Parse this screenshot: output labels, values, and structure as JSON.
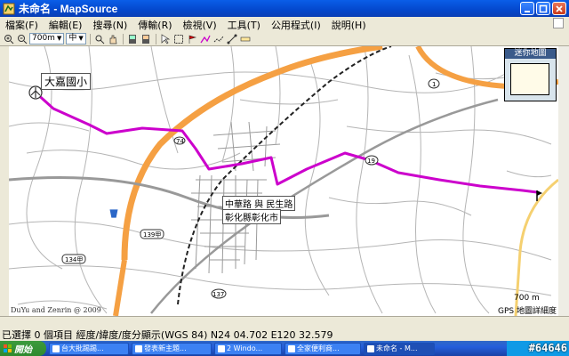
{
  "window": {
    "title": "未命名 - MapSource"
  },
  "menu": {
    "items": [
      "檔案(F)",
      "編輯(E)",
      "搜尋(N)",
      "傳輸(R)",
      "檢視(V)",
      "工具(T)",
      "公用程式(I)",
      "說明(H)"
    ]
  },
  "toolbar": {
    "zoom_value": "700m",
    "detail_value": "中"
  },
  "map": {
    "labels": {
      "start": "大嘉國小",
      "junction": "中華路 與 民生路",
      "city": "彰化縣彰化市",
      "highway_1": "1",
      "highway_19": "19",
      "highway_137": "137",
      "highway_139": "139甲",
      "highway_134": "134甲",
      "highway_74": "74"
    },
    "copyright": "DuYu and Zenrin @ 2009",
    "scale": "700 m",
    "accuracy": "GPS 地圖詳細度",
    "overview_title": "迷你地圖",
    "colors": {
      "route": "#cc00cc",
      "highway": "#f5a043",
      "road": "#bbbbbb",
      "rail": "#222222"
    }
  },
  "status": {
    "text": "已選擇 0 個項目   經度/緯度/度分顯示(WGS 84)   N24 04.702 E120 32.579"
  },
  "taskbar": {
    "start": "開始",
    "items": [
      "台大批踢踢...",
      "發表新主題...",
      "2 Windo...",
      "全家便利商...",
      "未命名 - M..."
    ],
    "watermark": "#64646"
  }
}
